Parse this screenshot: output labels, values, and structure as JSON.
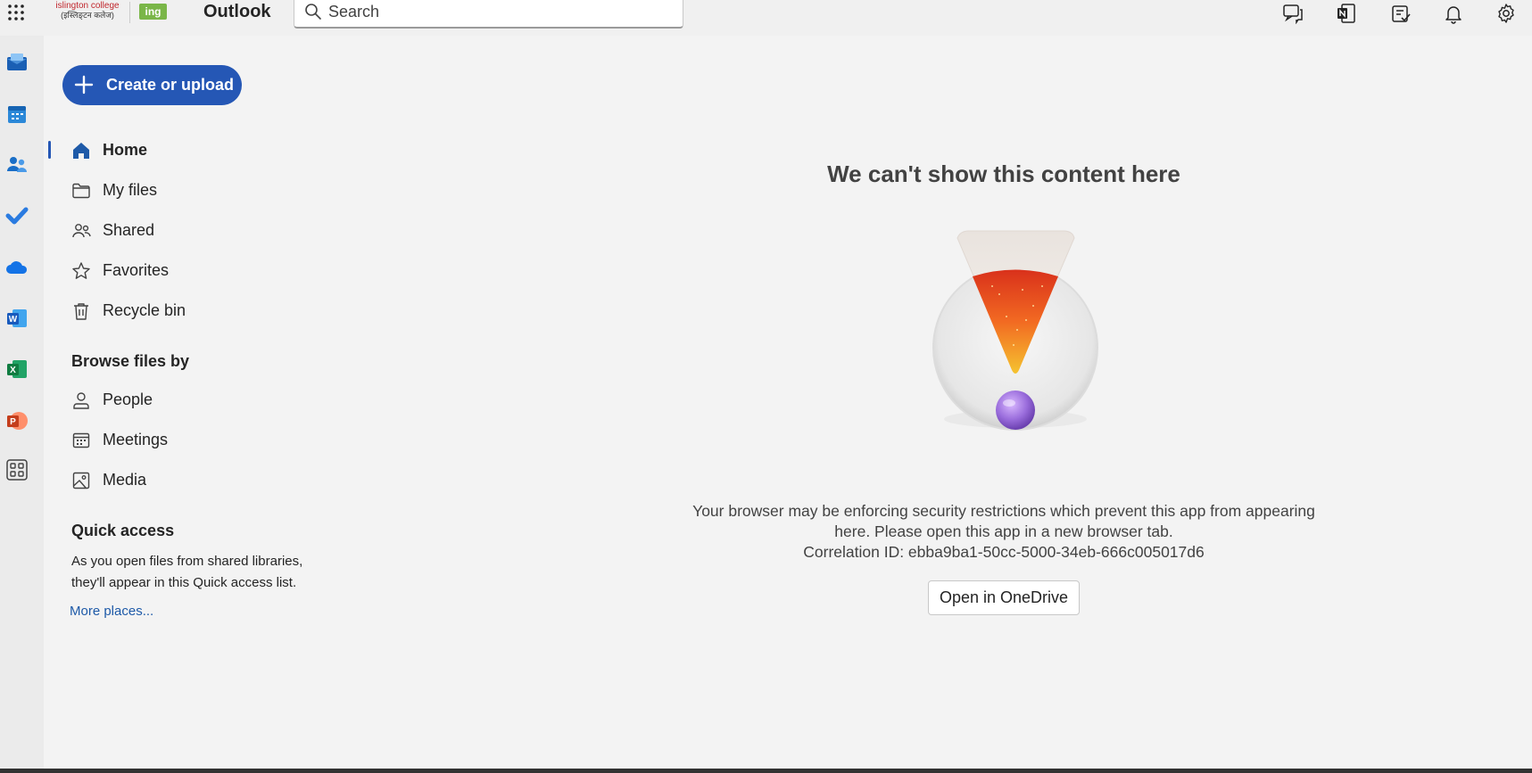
{
  "header": {
    "brand_line1": "islington college",
    "brand_line2": "(इस्लिङ्टन कलेज)",
    "brand_badge": "ing",
    "app_title": "Outlook",
    "search_placeholder": "Search"
  },
  "rail": {
    "apps": [
      "mail",
      "calendar",
      "people",
      "to-do",
      "onedrive",
      "word",
      "excel",
      "powerpoint",
      "more-apps"
    ]
  },
  "nav": {
    "create_label": "Create or upload",
    "items": [
      {
        "label": "Home",
        "icon": "home-icon"
      },
      {
        "label": "My files",
        "icon": "folder-icon"
      },
      {
        "label": "Shared",
        "icon": "people-icon"
      },
      {
        "label": "Favorites",
        "icon": "star-icon"
      },
      {
        "label": "Recycle bin",
        "icon": "trash-icon"
      }
    ],
    "browse_heading": "Browse files by",
    "browse_items": [
      {
        "label": "People",
        "icon": "person-icon"
      },
      {
        "label": "Meetings",
        "icon": "calendar-icon"
      },
      {
        "label": "Media",
        "icon": "image-icon"
      }
    ],
    "quick_access_heading": "Quick access",
    "quick_access_text": "As you open files from shared libraries, they'll appear in this Quick access list.",
    "more_places": "More places..."
  },
  "main": {
    "title": "We can't show this content here",
    "message_line1": "Your browser may be enforcing security restrictions which prevent this app from appearing here. Please open this app in a new browser tab.",
    "correlation": "Correlation ID: ebba9ba1-50cc-5000-34eb-666c005017d6",
    "open_button": "Open in OneDrive"
  },
  "colors": {
    "accent": "#2557b5",
    "link": "#1e5aa8",
    "background": "#f3f3f3"
  }
}
